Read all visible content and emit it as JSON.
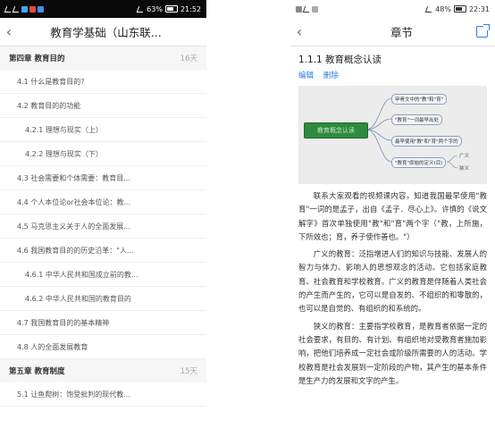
{
  "left": {
    "status": {
      "battery": "63%",
      "time": "21:52"
    },
    "title": "教育学基础（山东联...",
    "chapter4": {
      "label": "第四章 教育目的",
      "days": "16天"
    },
    "items": [
      {
        "label": "4.1 什么是教育目的?",
        "level": 1
      },
      {
        "label": "4.2 教育目的的功能",
        "level": 1
      },
      {
        "label": "4.2.1 理想与现实（上）",
        "level": 2
      },
      {
        "label": "4.2.2 理想与现实（下）",
        "level": 2
      },
      {
        "label": "4.3 社会需要和个体需要：教育目...",
        "level": 1
      },
      {
        "label": "4.4 个人本位论or社会本位论：教...",
        "level": 1
      },
      {
        "label": "4.5 马克思主义关于人的全面发展...",
        "level": 1
      },
      {
        "label": "4.6 我国教育目的的历史沿革：\"人...",
        "level": 1
      },
      {
        "label": "4.6.1 中华人民共和国成立前的教...",
        "level": 2
      },
      {
        "label": "4.6.2 中华人民共和国的教育目的",
        "level": 2
      },
      {
        "label": "4.7 我国教育目的的基本精神",
        "level": 1
      },
      {
        "label": "4.8 人的全面发展教育",
        "level": 1
      }
    ],
    "chapter5": {
      "label": "第五章 教育制度",
      "days": "15天"
    },
    "items2": [
      {
        "label": "5.1 让鱼爬树：饱受批判的现代教...",
        "level": 1
      }
    ]
  },
  "right": {
    "status": {
      "battery": "48%",
      "time": "22:31"
    },
    "title": "章节",
    "section_title": "1.1.1 教育概念认读",
    "actions": {
      "edit": "编辑",
      "delete": "删除"
    },
    "mindmap": {
      "center": "教育概念认读",
      "nodes": [
        "甲骨文中的\"教\"和\"育\"",
        "\"教育\"一词最早出处",
        "最早使用\"教\"和\"育\"两个字的",
        "\"教育\"原始的定义(目)"
      ],
      "small": [
        "广义",
        "狭义"
      ]
    },
    "paragraphs": [
      "联系大家观看的视频课内容，知道我国最早使用\"教育\"一词的是孟子，出自《孟子．尽心上》。许慎的《说文解字》首次单独使用\"教\"和\"育\"两个字（\"教，上所施，下所效也；育，养子使作善也。\"）",
      "广义的教育：泛指增进人们的知识与技能、发展人的智力与体力、影响人的思想观念的活动。它包括家庭教育、社会教育和学校教育。广义的教育是伴随着人类社会的产生而产生的，它可以是自发的、不组织的和零散的，也可以是自觉的、有组织的和系统的。",
      "狭义的教育：主要指学校教育，是教育者依据一定的社会要求，有目的、有计划、有组织地对受教育者施加影响，把他们培养成一定社会或阶级所需要的人的活动。学校教育是社会发展到一定阶段的产物，其产生的基本条件是生产力的发展和文字的产生。"
    ]
  }
}
